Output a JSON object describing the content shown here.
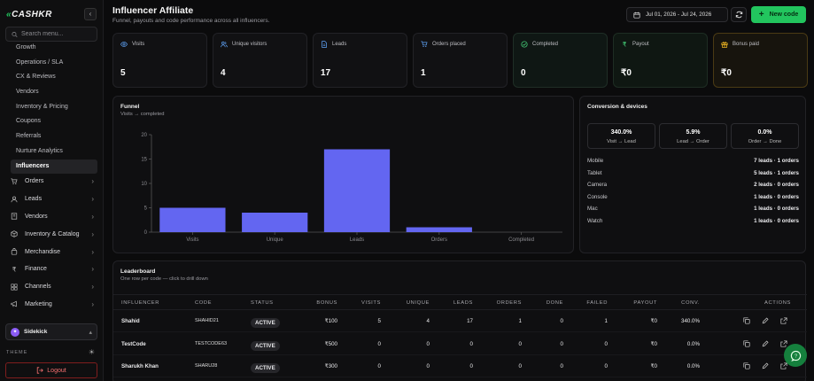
{
  "brand": {
    "name": "CASHKR"
  },
  "sidebar": {
    "search_placeholder": "Search menu...",
    "sub_items": [
      "Growth",
      "Operations / SLA",
      "CX & Reviews",
      "Vendors",
      "Inventory & Pricing",
      "Coupons",
      "Referrals",
      "Nurture Analytics",
      "Influencers"
    ],
    "active_sub": "Influencers",
    "nav_items": [
      {
        "label": "Orders",
        "icon": "cart-icon"
      },
      {
        "label": "Leads",
        "icon": "user-icon"
      },
      {
        "label": "Vendors",
        "icon": "building-icon"
      },
      {
        "label": "Inventory & Catalog",
        "icon": "box-icon"
      },
      {
        "label": "Merchandise",
        "icon": "bag-icon"
      },
      {
        "label": "Finance",
        "icon": "rupee-icon"
      },
      {
        "label": "Channels",
        "icon": "grid-icon"
      },
      {
        "label": "Marketing",
        "icon": "megaphone-icon"
      }
    ],
    "sidekick_label": "Sidekick",
    "theme_label": "THEME",
    "logout_label": "Logout"
  },
  "header": {
    "title": "Influencer Affiliate",
    "subtitle": "Funnel, payouts and code performance across all influencers.",
    "date_range": "Jul 01, 2026 - Jul 24, 2026",
    "new_code_label": "New code"
  },
  "kpis": [
    {
      "label": "Visits",
      "value": "5",
      "icon": "eye-icon"
    },
    {
      "label": "Unique visitors",
      "value": "4",
      "icon": "users-icon"
    },
    {
      "label": "Leads",
      "value": "17",
      "icon": "document-icon"
    },
    {
      "label": "Orders placed",
      "value": "1",
      "icon": "cart-icon"
    },
    {
      "label": "Completed",
      "value": "0",
      "icon": "check-circle-icon"
    },
    {
      "label": "Payout",
      "value": "₹0",
      "icon": "rupee-icon"
    },
    {
      "label": "Bonus paid",
      "value": "₹0",
      "icon": "gift-icon"
    }
  ],
  "funnel": {
    "title": "Funnel",
    "subtitle": "Visits → completed",
    "accent": "#6366f1"
  },
  "chart_data": {
    "type": "bar",
    "title": "Funnel",
    "subtitle": "Visits → completed",
    "categories": [
      "Visits",
      "Unique",
      "Leads",
      "Orders",
      "Completed"
    ],
    "values": [
      5,
      4,
      17,
      1,
      0
    ],
    "ylim": [
      0,
      20
    ],
    "yticks": [
      0,
      5,
      10,
      15,
      20
    ],
    "grid": false,
    "xlabel": "",
    "ylabel": ""
  },
  "conversion": {
    "title": "Conversion & devices",
    "boxes": [
      {
        "value": "340.0%",
        "label": "Visit → Lead"
      },
      {
        "value": "5.9%",
        "label": "Lead → Order"
      },
      {
        "value": "0.0%",
        "label": "Order → Done"
      }
    ],
    "devices": [
      {
        "name": "Mobile",
        "value": "7 leads · 1 orders"
      },
      {
        "name": "Tablet",
        "value": "5 leads · 1 orders"
      },
      {
        "name": "Camera",
        "value": "2 leads · 0 orders"
      },
      {
        "name": "Console",
        "value": "1 leads · 0 orders"
      },
      {
        "name": "Mac",
        "value": "1 leads · 0 orders"
      },
      {
        "name": "Watch",
        "value": "1 leads · 0 orders"
      }
    ]
  },
  "leaderboard": {
    "title": "Leaderboard",
    "subtitle": "One row per code — click to drill down",
    "columns": [
      "INFLUENCER",
      "CODE",
      "STATUS",
      "BONUS",
      "VISITS",
      "UNIQUE",
      "LEADS",
      "ORDERS",
      "DONE",
      "FAILED",
      "PAYOUT",
      "CONV.",
      "ACTIONS"
    ],
    "rows": [
      {
        "influencer": "Shahid",
        "code": "SHAHID21",
        "status": "ACTIVE",
        "bonus": "₹100",
        "visits": "5",
        "unique": "4",
        "leads": "17",
        "orders": "1",
        "done": "0",
        "failed": "1",
        "payout": "₹0",
        "conv": "340.0%"
      },
      {
        "influencer": "TestCode",
        "code": "TESTCODE63",
        "status": "ACTIVE",
        "bonus": "₹500",
        "visits": "0",
        "unique": "0",
        "leads": "0",
        "orders": "0",
        "done": "0",
        "failed": "0",
        "payout": "₹0",
        "conv": "0.0%"
      },
      {
        "influencer": "Sharukh Khan",
        "code": "SHARU28",
        "status": "ACTIVE",
        "bonus": "₹300",
        "visits": "0",
        "unique": "0",
        "leads": "0",
        "orders": "0",
        "done": "0",
        "failed": "0",
        "payout": "₹0",
        "conv": "0.0%"
      }
    ]
  }
}
